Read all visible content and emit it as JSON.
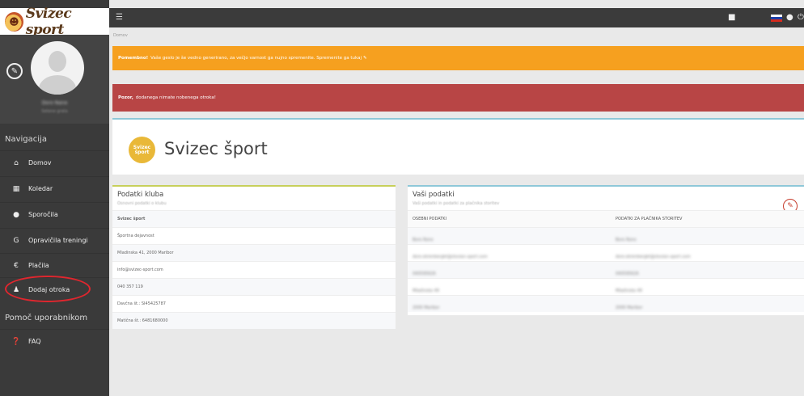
{
  "app": {
    "brand": "Svizec sport"
  },
  "profile": {
    "name": "Doro Nane",
    "subtitle": "Setene grata"
  },
  "sidebar": {
    "nav_heading": "Navigacija",
    "items": [
      {
        "label": "Domov",
        "icon": "home-icon"
      },
      {
        "label": "Koledar",
        "icon": "calendar-icon"
      },
      {
        "label": "Sporočila",
        "icon": "chat-icon"
      },
      {
        "label": "Opravičila treningi",
        "icon": "document-icon"
      },
      {
        "label": "Plačila",
        "icon": "euro-icon"
      },
      {
        "label": "Dodaj otroka",
        "icon": "user-icon"
      }
    ],
    "help_heading": "Pomoč uporabnikom",
    "help_items": [
      {
        "label": "FAQ",
        "icon": "question-icon"
      }
    ]
  },
  "breadcrumb": "Domov",
  "alerts": {
    "warning_strong": "Pomembno!",
    "warning_text": "Vaše geslo je še vedno generirano, za večjo varnost ga nujno spremenite. Spremenite ga tukaj",
    "danger_strong": "Pozor,",
    "danger_text": "dodanega nimate nobenega otroka!"
  },
  "club": {
    "logo_text": "Svizec šport",
    "title": "Svizec šport",
    "panel_title": "Podatki kluba",
    "panel_subtitle": "Osnovni podatki o klubu",
    "rows": [
      "Svizec šport",
      "Športna dejavnost",
      "Mladinska 41, 2000 Maribor",
      "info@svizec-sport.com",
      "040 357 119",
      "Davčna št.: SI45425787",
      "Matična št.: 6481680000"
    ]
  },
  "user": {
    "panel_title": "Vaši podatki",
    "panel_subtitle": "Vaši podatki in podatki za plačnika storitev",
    "col_personal": "OSEBNI PODATKI",
    "col_payer": "PODATKI ZA PLAČNIKA STORITEV",
    "rows": [
      {
        "personal": "Boro Rono",
        "payer": "Boro Rono"
      },
      {
        "personal": "doro.ekrenbergkt@slovian-sport.com",
        "payer": "doro.ekrenbergkt@slovian-sport.com"
      },
      {
        "personal": "040595626",
        "payer": "040595626"
      },
      {
        "personal": "Mladinska 49",
        "payer": "Mladinska 49"
      },
      {
        "personal": "2000 Maribor",
        "payer": "2000 Maribor"
      }
    ]
  }
}
